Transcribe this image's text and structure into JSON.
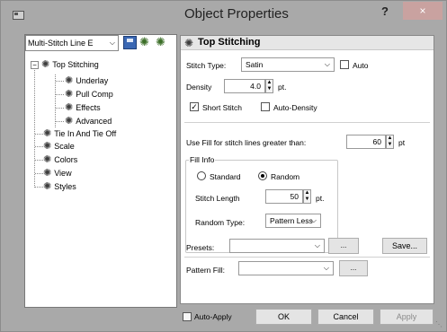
{
  "window": {
    "title": "Object Properties",
    "help_label": "?",
    "close_label": "×"
  },
  "left": {
    "object_type": "Multi-Stitch Line E",
    "tree": [
      "Top Stitching",
      "Underlay",
      "Pull Comp",
      "Effects",
      "Advanced",
      "Tie In And Tie Off",
      "Scale",
      "Colors",
      "View",
      "Styles"
    ]
  },
  "panel": {
    "title": "Top Stitching",
    "stitch_type_label": "Stitch Type:",
    "stitch_type_value": "Satin",
    "auto_label": "Auto",
    "auto_checked": false,
    "density_label": "Density",
    "density_value": "4.0",
    "density_unit": "pt.",
    "short_stitch_label": "Short Stitch",
    "short_stitch_checked": true,
    "auto_density_label": "Auto-Density",
    "auto_density_checked": false,
    "fill_label": "Use Fill for stitch lines greater than:",
    "fill_value": "60",
    "fill_unit": "pt",
    "fill_info": {
      "title": "Fill Info",
      "standard_label": "Standard",
      "random_label": "Random",
      "selected": "Random",
      "stitch_length_label": "Stitch Length",
      "stitch_length_value": "50",
      "stitch_length_unit": "pt.",
      "random_type_label": "Random Type:",
      "random_type_value": "Pattern Less"
    },
    "presets_label": "Presets:",
    "presets_value": "",
    "presets_more_label": "...",
    "save_label": "Save...",
    "pattern_fill_label": "Pattern Fill:",
    "pattern_fill_value": "",
    "pattern_more_label": "..."
  },
  "footer": {
    "auto_apply_label": "Auto-Apply",
    "auto_apply_checked": false,
    "ok_label": "OK",
    "cancel_label": "Cancel",
    "apply_label": "Apply"
  }
}
